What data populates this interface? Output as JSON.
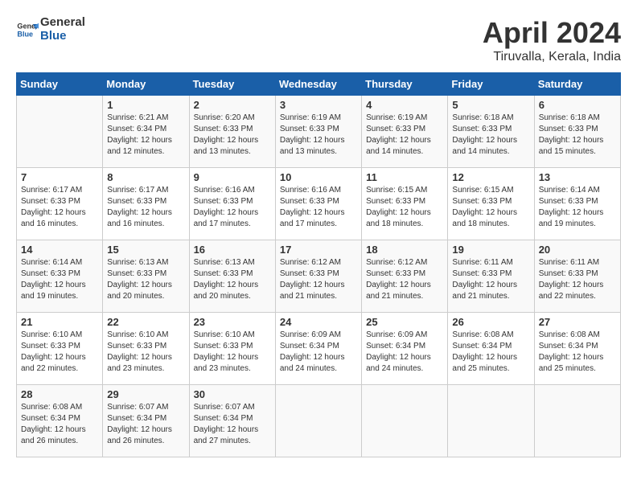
{
  "header": {
    "logo_line1": "General",
    "logo_line2": "Blue",
    "title": "April 2024",
    "subtitle": "Tiruvalla, Kerala, India"
  },
  "calendar": {
    "days_of_week": [
      "Sunday",
      "Monday",
      "Tuesday",
      "Wednesday",
      "Thursday",
      "Friday",
      "Saturday"
    ],
    "weeks": [
      [
        {
          "day": "",
          "info": ""
        },
        {
          "day": "1",
          "info": "Sunrise: 6:21 AM\nSunset: 6:34 PM\nDaylight: 12 hours\nand 12 minutes."
        },
        {
          "day": "2",
          "info": "Sunrise: 6:20 AM\nSunset: 6:33 PM\nDaylight: 12 hours\nand 13 minutes."
        },
        {
          "day": "3",
          "info": "Sunrise: 6:19 AM\nSunset: 6:33 PM\nDaylight: 12 hours\nand 13 minutes."
        },
        {
          "day": "4",
          "info": "Sunrise: 6:19 AM\nSunset: 6:33 PM\nDaylight: 12 hours\nand 14 minutes."
        },
        {
          "day": "5",
          "info": "Sunrise: 6:18 AM\nSunset: 6:33 PM\nDaylight: 12 hours\nand 14 minutes."
        },
        {
          "day": "6",
          "info": "Sunrise: 6:18 AM\nSunset: 6:33 PM\nDaylight: 12 hours\nand 15 minutes."
        }
      ],
      [
        {
          "day": "7",
          "info": "Sunrise: 6:17 AM\nSunset: 6:33 PM\nDaylight: 12 hours\nand 16 minutes."
        },
        {
          "day": "8",
          "info": "Sunrise: 6:17 AM\nSunset: 6:33 PM\nDaylight: 12 hours\nand 16 minutes."
        },
        {
          "day": "9",
          "info": "Sunrise: 6:16 AM\nSunset: 6:33 PM\nDaylight: 12 hours\nand 17 minutes."
        },
        {
          "day": "10",
          "info": "Sunrise: 6:16 AM\nSunset: 6:33 PM\nDaylight: 12 hours\nand 17 minutes."
        },
        {
          "day": "11",
          "info": "Sunrise: 6:15 AM\nSunset: 6:33 PM\nDaylight: 12 hours\nand 18 minutes."
        },
        {
          "day": "12",
          "info": "Sunrise: 6:15 AM\nSunset: 6:33 PM\nDaylight: 12 hours\nand 18 minutes."
        },
        {
          "day": "13",
          "info": "Sunrise: 6:14 AM\nSunset: 6:33 PM\nDaylight: 12 hours\nand 19 minutes."
        }
      ],
      [
        {
          "day": "14",
          "info": "Sunrise: 6:14 AM\nSunset: 6:33 PM\nDaylight: 12 hours\nand 19 minutes."
        },
        {
          "day": "15",
          "info": "Sunrise: 6:13 AM\nSunset: 6:33 PM\nDaylight: 12 hours\nand 20 minutes."
        },
        {
          "day": "16",
          "info": "Sunrise: 6:13 AM\nSunset: 6:33 PM\nDaylight: 12 hours\nand 20 minutes."
        },
        {
          "day": "17",
          "info": "Sunrise: 6:12 AM\nSunset: 6:33 PM\nDaylight: 12 hours\nand 21 minutes."
        },
        {
          "day": "18",
          "info": "Sunrise: 6:12 AM\nSunset: 6:33 PM\nDaylight: 12 hours\nand 21 minutes."
        },
        {
          "day": "19",
          "info": "Sunrise: 6:11 AM\nSunset: 6:33 PM\nDaylight: 12 hours\nand 21 minutes."
        },
        {
          "day": "20",
          "info": "Sunrise: 6:11 AM\nSunset: 6:33 PM\nDaylight: 12 hours\nand 22 minutes."
        }
      ],
      [
        {
          "day": "21",
          "info": "Sunrise: 6:10 AM\nSunset: 6:33 PM\nDaylight: 12 hours\nand 22 minutes."
        },
        {
          "day": "22",
          "info": "Sunrise: 6:10 AM\nSunset: 6:33 PM\nDaylight: 12 hours\nand 23 minutes."
        },
        {
          "day": "23",
          "info": "Sunrise: 6:10 AM\nSunset: 6:33 PM\nDaylight: 12 hours\nand 23 minutes."
        },
        {
          "day": "24",
          "info": "Sunrise: 6:09 AM\nSunset: 6:34 PM\nDaylight: 12 hours\nand 24 minutes."
        },
        {
          "day": "25",
          "info": "Sunrise: 6:09 AM\nSunset: 6:34 PM\nDaylight: 12 hours\nand 24 minutes."
        },
        {
          "day": "26",
          "info": "Sunrise: 6:08 AM\nSunset: 6:34 PM\nDaylight: 12 hours\nand 25 minutes."
        },
        {
          "day": "27",
          "info": "Sunrise: 6:08 AM\nSunset: 6:34 PM\nDaylight: 12 hours\nand 25 minutes."
        }
      ],
      [
        {
          "day": "28",
          "info": "Sunrise: 6:08 AM\nSunset: 6:34 PM\nDaylight: 12 hours\nand 26 minutes."
        },
        {
          "day": "29",
          "info": "Sunrise: 6:07 AM\nSunset: 6:34 PM\nDaylight: 12 hours\nand 26 minutes."
        },
        {
          "day": "30",
          "info": "Sunrise: 6:07 AM\nSunset: 6:34 PM\nDaylight: 12 hours\nand 27 minutes."
        },
        {
          "day": "",
          "info": ""
        },
        {
          "day": "",
          "info": ""
        },
        {
          "day": "",
          "info": ""
        },
        {
          "day": "",
          "info": ""
        }
      ]
    ]
  }
}
